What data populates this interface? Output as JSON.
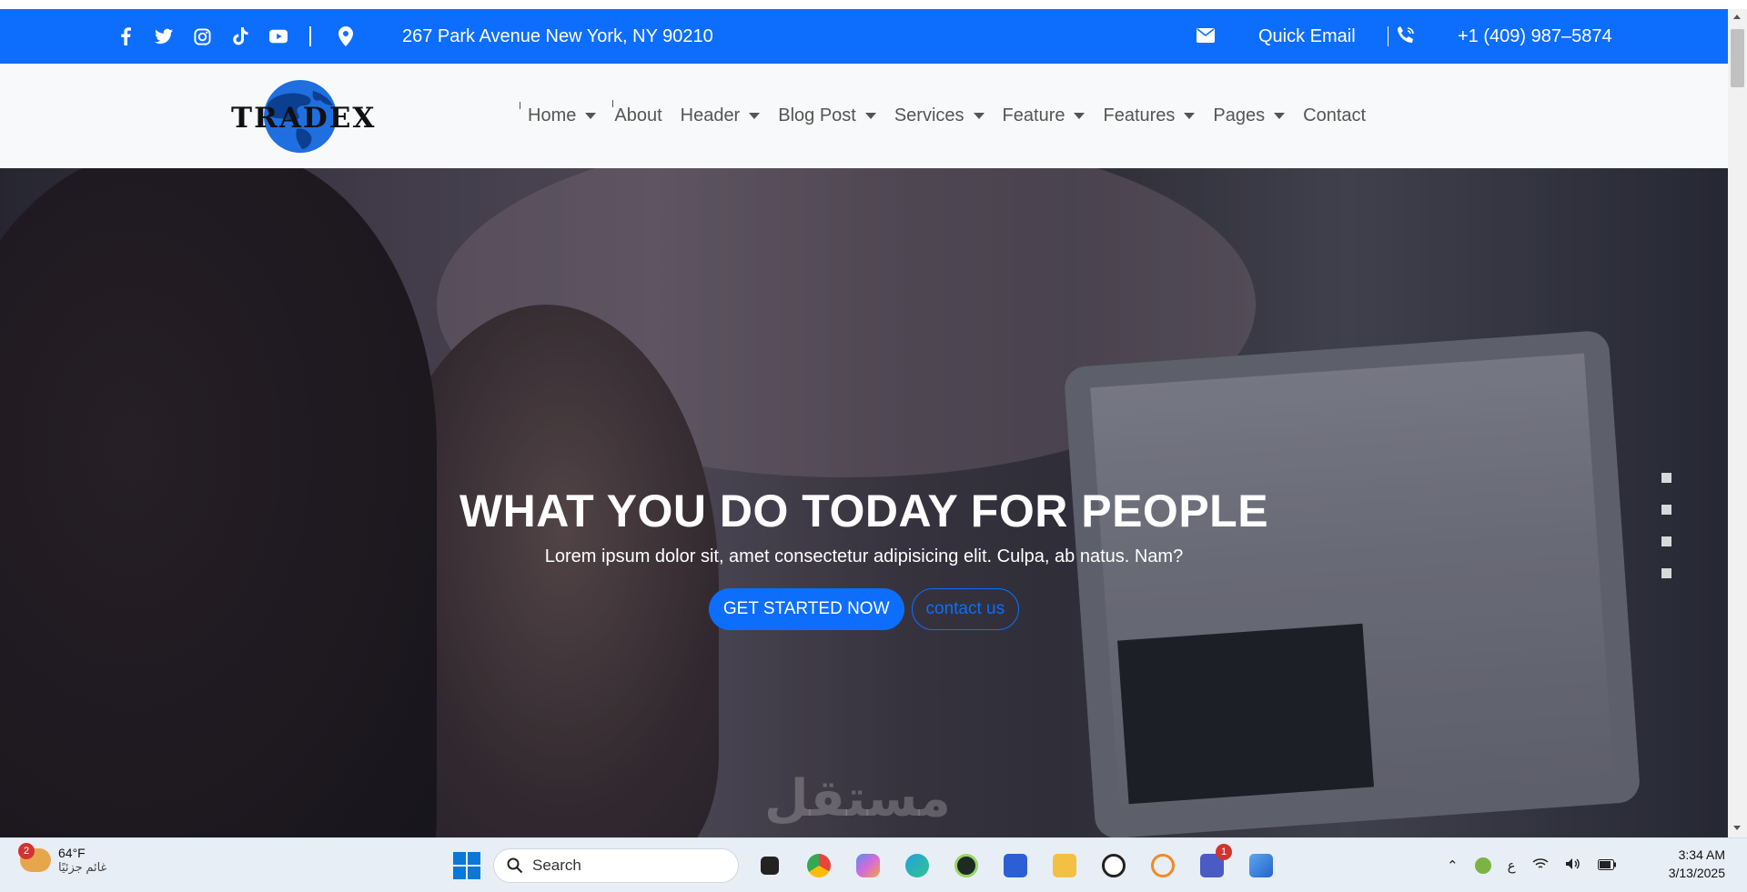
{
  "topbar": {
    "social": [
      "facebook-icon",
      "twitter-icon",
      "instagram-icon",
      "tiktok-icon",
      "youtube-icon"
    ],
    "address": "267 Park Avenue New York, NY 90210",
    "quick_email": "Quick Email",
    "phone": "+1 (409) 987–5874",
    "bg_color": "#0d6efd"
  },
  "brand": {
    "logo_text": "TRADEX"
  },
  "nav": {
    "items": [
      {
        "label": "Home",
        "dropdown": true
      },
      {
        "label": "About",
        "dropdown": false
      },
      {
        "label": "Header",
        "dropdown": true
      },
      {
        "label": "Blog Post",
        "dropdown": true
      },
      {
        "label": "Services",
        "dropdown": true
      },
      {
        "label": "Feature",
        "dropdown": true
      },
      {
        "label": "Features",
        "dropdown": true
      },
      {
        "label": "Pages",
        "dropdown": true
      },
      {
        "label": "Contact",
        "dropdown": false
      }
    ]
  },
  "hero": {
    "title": "WHAT YOU DO TODAY FOR PEOPLE",
    "subtitle": "Lorem ipsum dolor sit, amet consectetur adipisicing elit. Culpa, ab natus. Nam?",
    "primary_button": "GET STARTED NOW",
    "secondary_button": "contact us",
    "slide_count": 4,
    "watermark": "مستقل"
  },
  "taskbar": {
    "weather_temp": "64°F",
    "weather_desc": "غائم جزئيًا",
    "weather_badge": "2",
    "search_label": "Search",
    "teams_badge": "1",
    "lang": "ع",
    "time": "3:34 AM",
    "date": "3/13/2025"
  }
}
